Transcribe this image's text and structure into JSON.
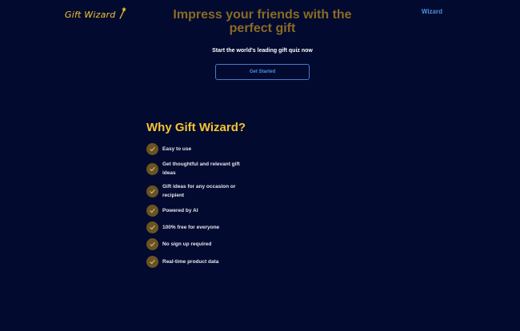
{
  "header": {
    "logo_text": "Gift Wizard",
    "nav_link": "Wizard"
  },
  "hero": {
    "title": "Impress your friends with the perfect gift",
    "subtitle": "Start the world's leading gift quiz now",
    "cta_label": "Get Started"
  },
  "why": {
    "title": "Why Gift Wizard?",
    "features": [
      "Easy to use",
      "Get thoughtful and relevant gift ideas",
      "Gift ideas for any occasion or recipient",
      "Powered by AI",
      "100% free for everyone",
      "No sign up required",
      "Real-time product data"
    ]
  },
  "colors": {
    "background": "#020a2f",
    "accent_gold": "#f4c430",
    "muted_gold": "#8a6a24",
    "link_blue": "#4a90e2",
    "check_bg": "#6b5321"
  },
  "icons": {
    "logo": "magic-wand-icon",
    "feature": "check-icon"
  }
}
